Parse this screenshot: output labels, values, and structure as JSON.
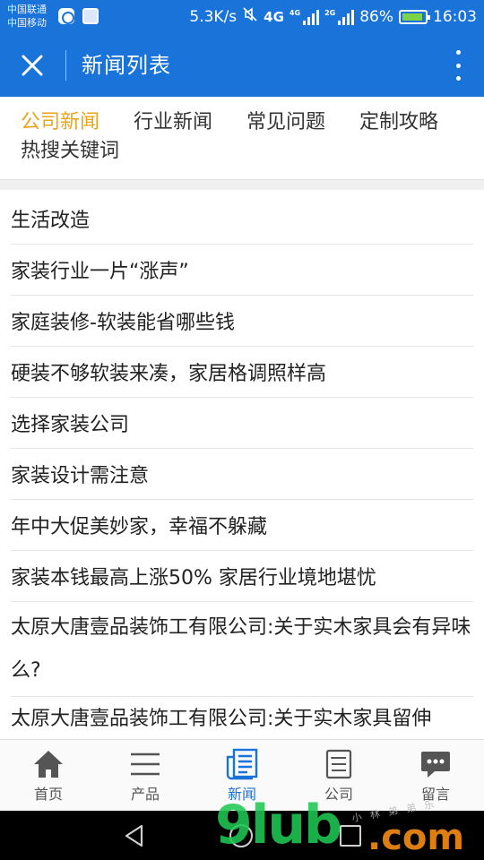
{
  "statusbar": {
    "carrier1": "中国联通",
    "carrier2": "中国移动",
    "speed": "5.3K/s",
    "net_4g": "4G",
    "net_4g_small": "4G",
    "net_2g": "2G",
    "battery": "86%",
    "time": "16:03"
  },
  "appbar": {
    "title": "新闻列表",
    "close_icon": "close-icon",
    "more_icon": "more-vertical-icon"
  },
  "categories": [
    {
      "label": "公司新闻",
      "active": true
    },
    {
      "label": "行业新闻",
      "active": false
    },
    {
      "label": "常见问题",
      "active": false
    },
    {
      "label": "定制攻略",
      "active": false
    },
    {
      "label": "热搜关键词",
      "active": false
    }
  ],
  "news": [
    "生活改造",
    "家装行业一片“涨声”",
    "家庭装修-软装能省哪些钱",
    "硬装不够软装来凑，家居格调照样高",
    "选择家装公司",
    "家装设计需注意",
    "年中大促美妙家，幸福不躲藏",
    "家装本钱最高上涨50% 家居行业境地堪忧",
    "太原大唐壹品装饰工有限公司:关于实木家具会有异味么?",
    "太原大唐壹品装饰工有限公司:关于实木家具留伸"
  ],
  "bottom_nav": [
    {
      "label": "首页",
      "icon": "home-icon",
      "active": false
    },
    {
      "label": "产品",
      "icon": "menu-icon",
      "active": false
    },
    {
      "label": "新闻",
      "icon": "newspaper-icon",
      "active": true
    },
    {
      "label": "公司",
      "icon": "document-icon",
      "active": false
    },
    {
      "label": "留言",
      "icon": "chat-icon",
      "active": false
    }
  ],
  "watermark": {
    "main": "9lub",
    "suffix": ".com",
    "small": "小 林 弟 弟 乐"
  },
  "colors": {
    "primary": "#1a73d8",
    "accent": "#e8a51c"
  }
}
